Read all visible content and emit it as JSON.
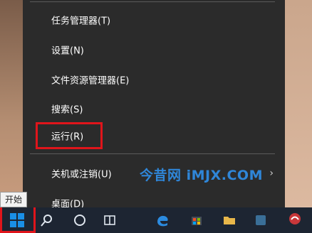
{
  "menu": {
    "items": [
      {
        "label": "任务管理器(T)"
      },
      {
        "label": "设置(N)"
      },
      {
        "label": "文件资源管理器(E)"
      },
      {
        "label": "搜索(S)"
      },
      {
        "label": "运行(R)"
      },
      {
        "label": "关机或注销(U)",
        "submenu": "›"
      },
      {
        "label": "桌面(D)"
      }
    ]
  },
  "watermark": "今昔网 iMJX.COM",
  "start": {
    "tooltip": "开始"
  },
  "colors": {
    "menu_bg": "#2b2b2b",
    "highlight": "#e0151b",
    "watermark": "#2f86d8",
    "taskbar": "#1d2532",
    "windows_logo": "#1a8fe6"
  },
  "taskbar": {
    "icons": [
      "windows-logo-icon",
      "search-icon",
      "cortana-icon",
      "task-view-icon",
      "edge-icon",
      "store-icon",
      "folder-icon",
      "app-icon",
      "weather-icon"
    ]
  }
}
